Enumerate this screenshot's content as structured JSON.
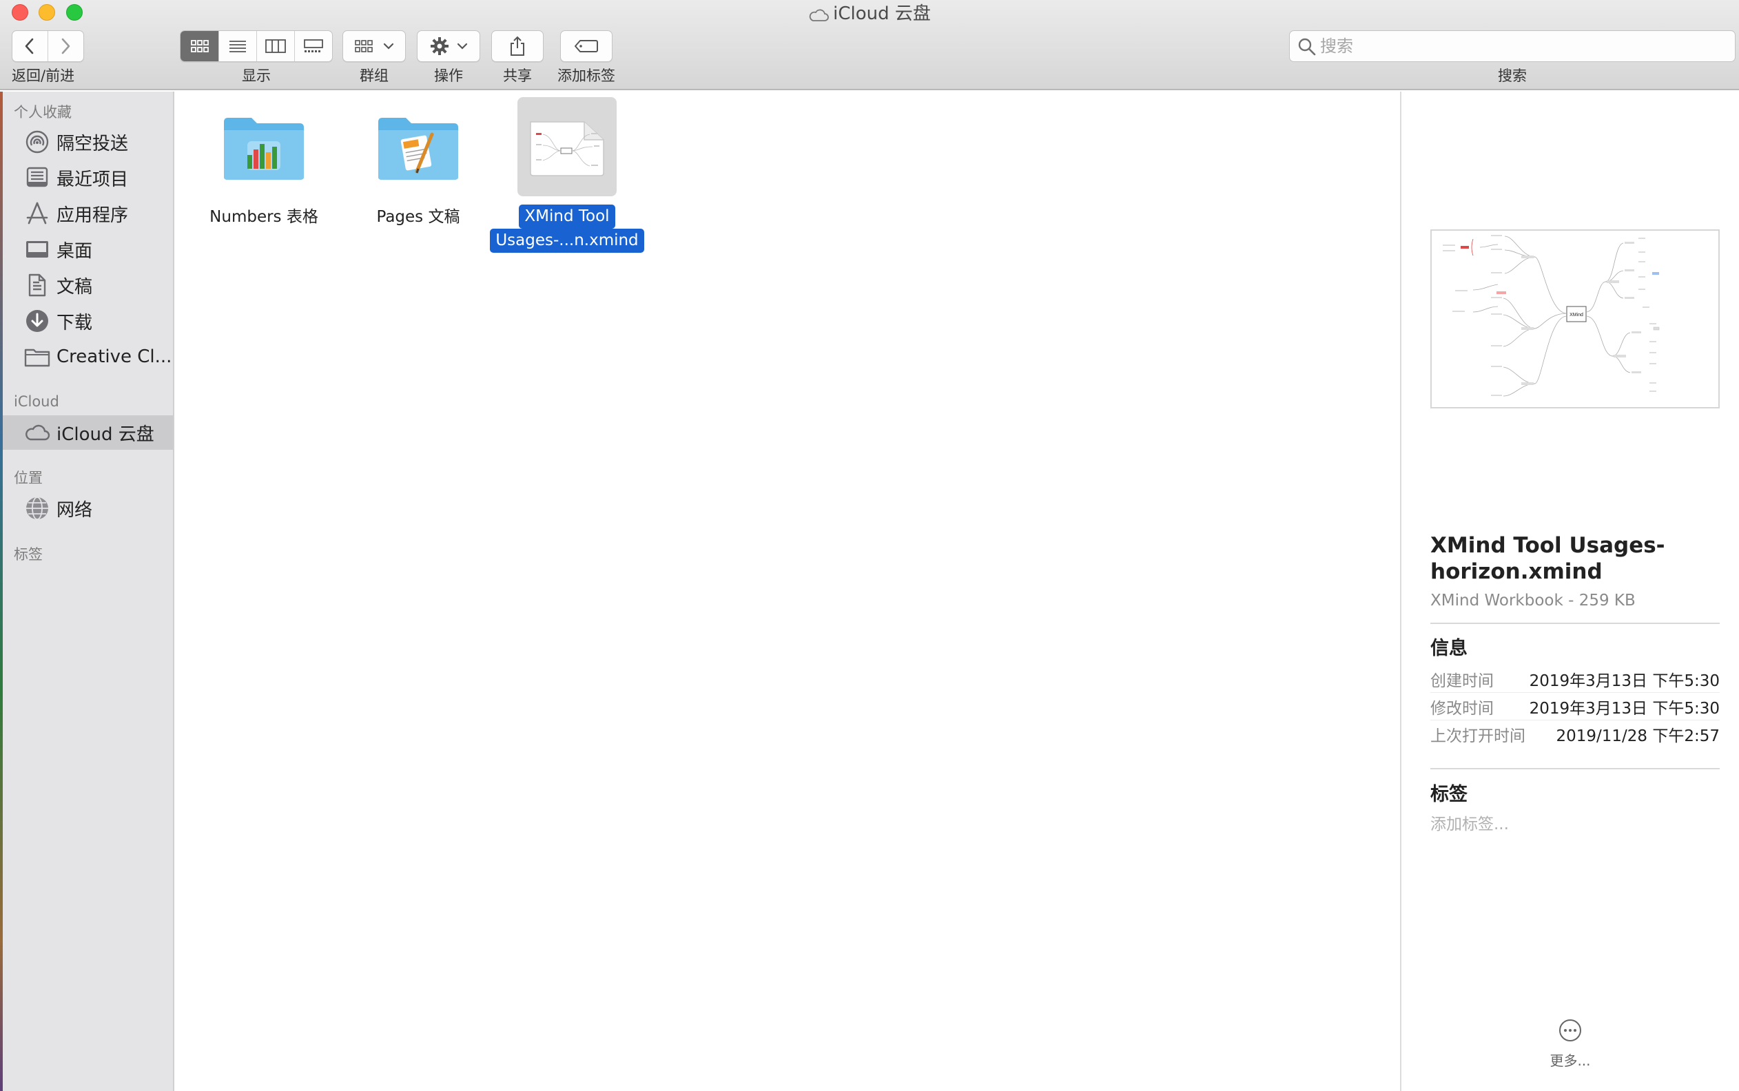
{
  "window": {
    "title": "iCloud 云盘"
  },
  "toolbar": {
    "back_forward_label": "返回/前进",
    "view_label": "显示",
    "group_label": "群组",
    "action_label": "操作",
    "share_label": "共享",
    "tags_label": "添加标签",
    "search_label": "搜索",
    "search_placeholder": "搜索",
    "active_view": "icon"
  },
  "sidebar": {
    "favorites_heading": "个人收藏",
    "favorites": [
      {
        "label": "隔空投送",
        "icon": "airdrop-icon"
      },
      {
        "label": "最近项目",
        "icon": "recents-icon"
      },
      {
        "label": "应用程序",
        "icon": "applications-icon"
      },
      {
        "label": "桌面",
        "icon": "desktop-icon"
      },
      {
        "label": "文稿",
        "icon": "documents-icon"
      },
      {
        "label": "下载",
        "icon": "downloads-icon"
      },
      {
        "label": "Creative Cl...",
        "icon": "folder-icon"
      }
    ],
    "icloud_heading": "iCloud",
    "icloud_items": [
      {
        "label": "iCloud 云盘",
        "icon": "icloud-icon",
        "selected": true
      }
    ],
    "locations_heading": "位置",
    "locations": [
      {
        "label": "网络",
        "icon": "network-icon"
      }
    ],
    "tags_heading": "标签"
  },
  "files": [
    {
      "name": "Numbers 表格",
      "type": "numbers-folder"
    },
    {
      "name": "Pages 文稿",
      "type": "pages-folder"
    },
    {
      "name_line1": "XMind Tool",
      "name_line2": "Usages-...n.xmind",
      "type": "xmind-file",
      "selected": true
    }
  ],
  "preview": {
    "title": "XMind Tool Usages-horizon.xmind",
    "subtitle": "XMind Workbook - 259 KB",
    "info_heading": "信息",
    "info": [
      {
        "key": "创建时间",
        "value": "2019年3月13日 下午5:30"
      },
      {
        "key": "修改时间",
        "value": "2019年3月13日 下午5:30"
      },
      {
        "key": "上次打开时间",
        "value": "2019/11/28 下午2:57"
      }
    ],
    "tags_heading": "标签",
    "tags_placeholder": "添加标签...",
    "more_label": "更多...",
    "thumbnail_center_label": "XMind",
    "accent_color": "#1862d2"
  }
}
